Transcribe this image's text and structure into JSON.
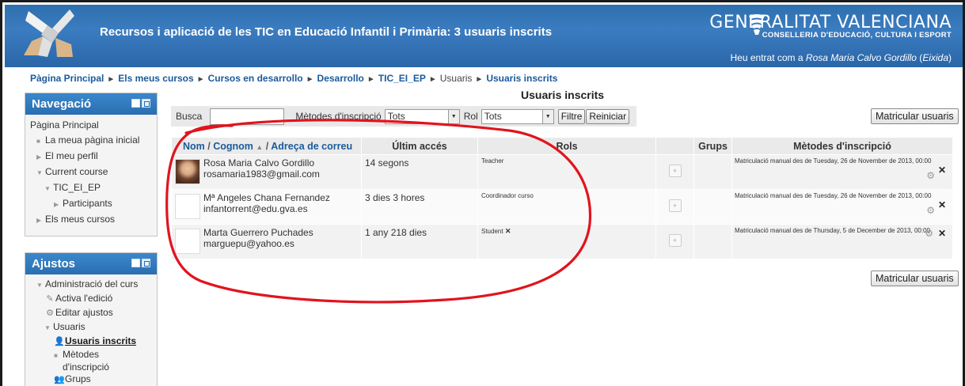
{
  "header": {
    "title": "Recursos i aplicació de les TIC en Educació Infantil i Primària: 3 usuaris inscrits",
    "org_name": "GENERALITAT VALENCIANA",
    "org_sub": "CONSELLERIA D'EDUCACIÓ, CULTURA I ESPORT",
    "login_prefix": "Heu entrat com a ",
    "login_user": "Rosa Maria Calvo Gordillo",
    "login_logout": "Eixida"
  },
  "breadcrumb": [
    "Pàgina Principal",
    "Els meus cursos",
    "Cursos en desarrollo",
    "Desarrollo",
    "TIC_EI_EP",
    "Usuaris",
    "Usuaris inscrits"
  ],
  "navigation": {
    "title": "Navegació",
    "items": [
      "Pàgina Principal",
      "La meua pàgina inicial",
      "El meu perfil",
      "Current course",
      "TIC_EI_EP",
      "Participants",
      "Els meus cursos"
    ]
  },
  "settings": {
    "title": "Ajustos",
    "items": [
      "Administració del curs",
      "Activa l'edició",
      "Editar ajustos",
      "Usuaris",
      "Usuaris inscrits",
      "Mètodes",
      "d'inscripció",
      "Grups"
    ]
  },
  "main": {
    "heading": "Usuaris inscrits",
    "filter": {
      "search_label": "Busca",
      "search_value": "",
      "methods_label": "Mètodes d'inscripció",
      "methods_value": "Tots",
      "role_label": "Rol",
      "role_value": "Tots",
      "filter_button": "Filtre",
      "reset_button": "Reiniciar"
    },
    "enrol_button": "Matricular usuaris",
    "columns": {
      "name_first": "Nom",
      "name_sep1": " / ",
      "name_last": "Cognom",
      "name_sep2": " / ",
      "name_email": "Adreça de correu",
      "last_access": "Últim accés",
      "roles": "Rols",
      "groups": "Grups",
      "methods": "Mètodes d'inscripció"
    },
    "rows": [
      {
        "name": "Rosa Maria Calvo Gordillo",
        "email": "rosamaria1983@gmail.com",
        "last_access": "14 segons",
        "role": "Teacher",
        "method": "Matriculació manual des de Tuesday, 26 de November de 2013, 00:00"
      },
      {
        "name": "Mª Angeles Chana Fernandez",
        "email": "infantorrent@edu.gva.es",
        "last_access": "3 dies 3 hores",
        "role": "Coordinador curso",
        "method": "Matriculació manual des de Tuesday, 26 de November de 2013, 00:00"
      },
      {
        "name": "Marta Guerrero Puchades",
        "email": "marguepu@yahoo.es",
        "last_access": "1 any 218 dies",
        "role": "Student",
        "method": "Matriculació manual des de Thursday, 5 de December de 2013, 00:00"
      }
    ]
  },
  "colors": {
    "header_blue": "#2e6fae",
    "link_blue": "#1a5a9c",
    "annotation_red": "#e0141e"
  }
}
